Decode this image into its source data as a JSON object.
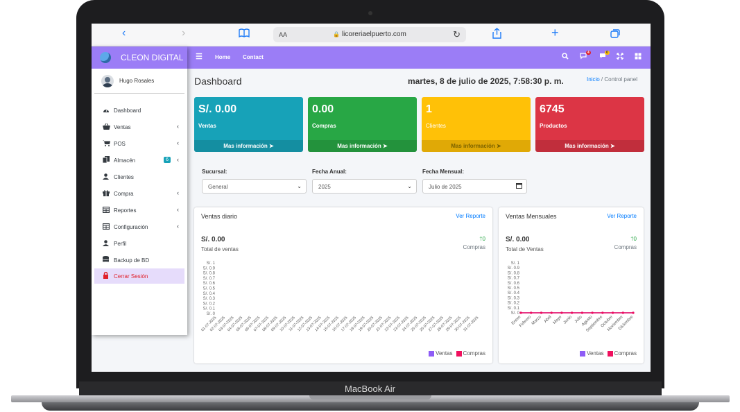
{
  "device": {
    "label": "MacBook Air"
  },
  "browser": {
    "url": "licoreriaelpuerto.com",
    "aa": "AA"
  },
  "app": {
    "brand": "CLEON DIGITAL"
  },
  "user": {
    "name": "Hugo Rosales"
  },
  "sidebar": {
    "items": [
      {
        "label": "Dashboard",
        "icon": "dashboard-icon",
        "has_chevron": false
      },
      {
        "label": "Ventas",
        "icon": "basket-icon",
        "has_chevron": true
      },
      {
        "label": "POS",
        "icon": "cart-icon",
        "has_chevron": true
      },
      {
        "label": "Almacén",
        "icon": "copy-icon",
        "has_chevron": true,
        "badge": "6"
      },
      {
        "label": "Clientes",
        "icon": "user-icon",
        "has_chevron": false
      },
      {
        "label": "Compra",
        "icon": "gift-icon",
        "has_chevron": true
      },
      {
        "label": "Reportes",
        "icon": "table-icon",
        "has_chevron": true
      },
      {
        "label": "Configuración",
        "icon": "table-icon",
        "has_chevron": true
      },
      {
        "label": "Perfil",
        "icon": "user-icon",
        "has_chevron": false
      },
      {
        "label": "Backup de BD",
        "icon": "database-icon",
        "has_chevron": false
      }
    ],
    "logout": "Cerrar Sesión"
  },
  "topnav": {
    "home": "Home",
    "contact": "Contact",
    "notif_badge_1": "4",
    "notif_badge_2": "0"
  },
  "header": {
    "title": "Dashboard",
    "datetime": "martes, 8 de julio de 2025, 7:58:30 p. m.",
    "breadcrumb_home": "Inicio",
    "breadcrumb_sep": "/",
    "breadcrumb_current": "Control panel"
  },
  "cards": [
    {
      "value": "S/. 0.00",
      "label": "Ventas",
      "footer": "Mas información",
      "color": "#17a2b8"
    },
    {
      "value": "0.00",
      "label": "Compras",
      "footer": "Mas información",
      "color": "#28a745"
    },
    {
      "value": "1",
      "label": "Clientes",
      "footer": "Mas información",
      "color": "#ffc107"
    },
    {
      "value": "6745",
      "label": "Productos",
      "footer": "Mas información",
      "color": "#dc3545"
    }
  ],
  "filters": {
    "sucursal": {
      "label": "Sucursal:",
      "value": "General"
    },
    "anual": {
      "label": "Fecha Anual:",
      "value": "2025"
    },
    "mensual": {
      "label": "Fecha Mensual:",
      "value": "Julio de 2025"
    }
  },
  "panels": {
    "daily": {
      "title": "Ventas diario",
      "link": "Ver Reporte",
      "amount": "S/. 0.00",
      "sub": "Total de ventas",
      "up": "0",
      "compras": "Compras"
    },
    "monthly": {
      "title": "Ventas Mensuales",
      "link": "Ver Reporte",
      "amount": "S/. 0.00",
      "sub": "Total de Ventas",
      "up": "0",
      "compras": "Compras"
    }
  },
  "legend": {
    "ventas": "Ventas",
    "compras": "Compras",
    "ventas_color": "#8e5cf6",
    "compras_color": "#f0105e"
  },
  "chart_data": [
    {
      "type": "line",
      "yticks": [
        "S/. 1",
        "S/. 0.9",
        "S/. 0.8",
        "S/. 0.7",
        "S/. 0.6",
        "S/. 0.5",
        "S/. 0.4",
        "S/. 0.3",
        "S/. 0.2",
        "S/. 0.1",
        "S/. 0"
      ],
      "ylim": [
        0,
        1
      ],
      "categories": [
        "01-07-2025",
        "02-07-2025",
        "03-07-2025",
        "04-07-2025",
        "05-07-2025",
        "06-07-2025",
        "07-07-2025",
        "08-07-2025",
        "09-07-2025",
        "10-07-2025",
        "11-07-2025",
        "12-07-2025",
        "13-07-2025",
        "14-07-2025",
        "15-07-2025",
        "16-07-2025",
        "17-07-2025",
        "18-07-2025",
        "19-07-2025",
        "20-07-2025",
        "21-07-2025",
        "22-07-2025",
        "23-07-2025",
        "24-07-2025",
        "25-07-2025",
        "26-07-2025",
        "27-07-2025",
        "28-07-2025",
        "29-07-2025",
        "30-07-2025",
        "31-07-2025"
      ],
      "series": [
        {
          "name": "Ventas",
          "values": []
        },
        {
          "name": "Compras",
          "values": []
        }
      ]
    },
    {
      "type": "line",
      "yticks": [
        "S/. 1",
        "S/. 0.9",
        "S/. 0.8",
        "S/. 0.7",
        "S/. 0.6",
        "S/. 0.5",
        "S/. 0.4",
        "S/. 0.3",
        "S/. 0.2",
        "S/. 0.1",
        "S/. 0"
      ],
      "ylim": [
        0,
        1
      ],
      "categories": [
        "Enero",
        "Febrero",
        "Marzo",
        "Abril",
        "Mayo",
        "Junio",
        "Julio",
        "Agosto",
        "Septiembre",
        "Octubre",
        "Noviembre",
        "Diciembre"
      ],
      "series": [
        {
          "name": "Ventas",
          "values": [
            0,
            0,
            0,
            0,
            0,
            0,
            0,
            0,
            0,
            0,
            0,
            0
          ]
        },
        {
          "name": "Compras",
          "values": [
            0,
            0,
            0,
            0,
            0,
            0,
            0,
            0,
            0,
            0,
            0,
            0
          ]
        }
      ]
    }
  ]
}
